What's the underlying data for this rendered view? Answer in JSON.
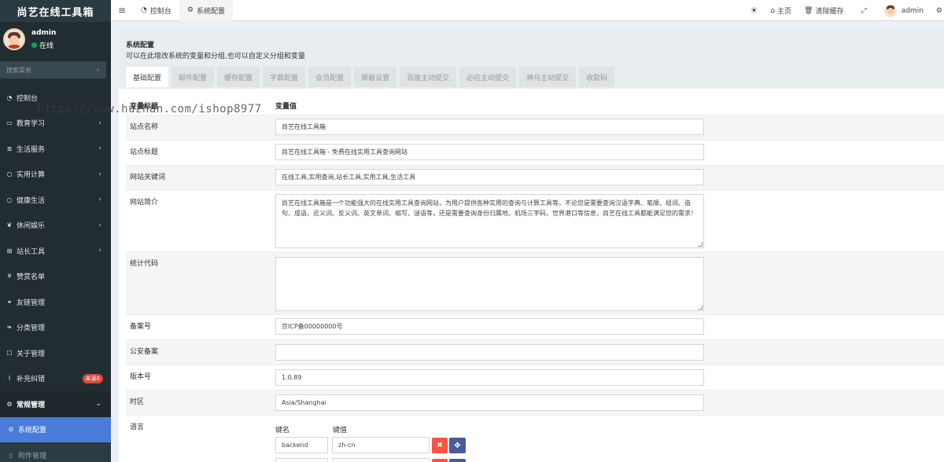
{
  "app": {
    "brand": "尚艺在线工具箱"
  },
  "user": {
    "name": "admin",
    "status": "在线"
  },
  "sidebar": {
    "search_placeholder": "搜索菜单",
    "items": [
      {
        "label": "控制台",
        "icon": "dashboard-icon",
        "glyph": "◔",
        "chevron": false
      },
      {
        "label": "教育学习",
        "icon": "monitor-icon",
        "glyph": "▭",
        "chevron": true
      },
      {
        "label": "生活服务",
        "icon": "list-icon",
        "glyph": "≣",
        "chevron": true
      },
      {
        "label": "实用计算",
        "icon": "circle-icon",
        "glyph": "○",
        "chevron": true
      },
      {
        "label": "健康生活",
        "icon": "circle-icon",
        "glyph": "○",
        "chevron": true
      },
      {
        "label": "休闲娱乐",
        "icon": "leaf-icon",
        "glyph": "❦",
        "chevron": true
      },
      {
        "label": "站长工具",
        "icon": "sitemap-icon",
        "glyph": "⊞",
        "chevron": true
      },
      {
        "label": "赞赏名单",
        "icon": "yen-icon",
        "glyph": "¥",
        "chevron": false
      },
      {
        "label": "友链管理",
        "icon": "link-icon",
        "glyph": "⚭",
        "chevron": false
      },
      {
        "label": "分类管理",
        "icon": "leaf-icon",
        "glyph": "❧",
        "chevron": false
      },
      {
        "label": "关于管理",
        "icon": "square-icon",
        "glyph": "☐",
        "chevron": false
      },
      {
        "label": "补充纠错",
        "icon": "text-cursor-icon",
        "glyph": "I",
        "chevron": false,
        "badge": "未读0"
      }
    ],
    "group": {
      "label": "常规管理",
      "icon": "gears-icon",
      "glyph": "⚙"
    },
    "active": {
      "label": "系统配置",
      "icon": "gear-icon",
      "glyph": "⚙"
    },
    "sub": {
      "label": "附件管理",
      "icon": "file-icon",
      "glyph": "▯"
    }
  },
  "topbar": {
    "tabs": [
      {
        "label": "控制台",
        "glyph": "◔",
        "icon": "dashboard-icon"
      },
      {
        "label": "系统配置",
        "glyph": "⚙",
        "icon": "gear-icon"
      }
    ],
    "right": {
      "home": "主页",
      "clear_cache": "清除缓存",
      "username": "admin"
    }
  },
  "panel": {
    "title": "系统配置",
    "description": "可以在此增改系统的变量和分组,也可以自定义分组和变量",
    "tabs": [
      "基础配置",
      "邮件配置",
      "缓存配置",
      "字典配置",
      "会员配置",
      "屏蔽设置",
      "百度主动提交",
      "必应主动提交",
      "神马主动提交",
      "收款码"
    ]
  },
  "table": {
    "col_title": "变量标题",
    "col_value": "变量值",
    "rows": {
      "site_name": {
        "label": "站点名称",
        "value": "尚艺在线工具箱"
      },
      "site_title": {
        "label": "站点标题",
        "value": "尚艺在线工具箱 - 免费在线实用工具查询网站"
      },
      "keywords": {
        "label": "网站关键词",
        "value": "在线工具,实用查询,站长工具,实用工具,生活工具"
      },
      "intro": {
        "label": "网站简介",
        "value": "尚艺在线工具箱是一个功能强大的在线实用工具查询网站，为用户提供各种实用的查询与计算工具等。不论您是需要查询汉语字典、笔顺、组词、造句、成语、近义词、反义词、英文单词、缩写、谜语等，还是需要查询身份归属地、机场三字码、世界港口等信息，尚艺在线工具都能满足您的需求！"
      },
      "stats": {
        "label": "统计代码",
        "value": ""
      },
      "icp": {
        "label": "备案号",
        "value": "京ICP备00000000号"
      },
      "police": {
        "label": "公安备案",
        "value": ""
      },
      "version": {
        "label": "版本号",
        "value": "1.0.89"
      },
      "timezone": {
        "label": "时区",
        "value": "Asia/Shanghai"
      },
      "language": {
        "label": "语言",
        "key_header": "键名",
        "value_header": "键值",
        "pairs": [
          {
            "key": "backend",
            "value": "zh-cn"
          },
          {
            "key": "",
            "value": ""
          }
        ]
      }
    }
  },
  "watermark": "https://www.huzhan.com/ishop8977",
  "colors": {
    "sidebar": "#222d32",
    "active": "#4a7bd8",
    "delete": "#f75444",
    "move": "#4a5b9c"
  }
}
